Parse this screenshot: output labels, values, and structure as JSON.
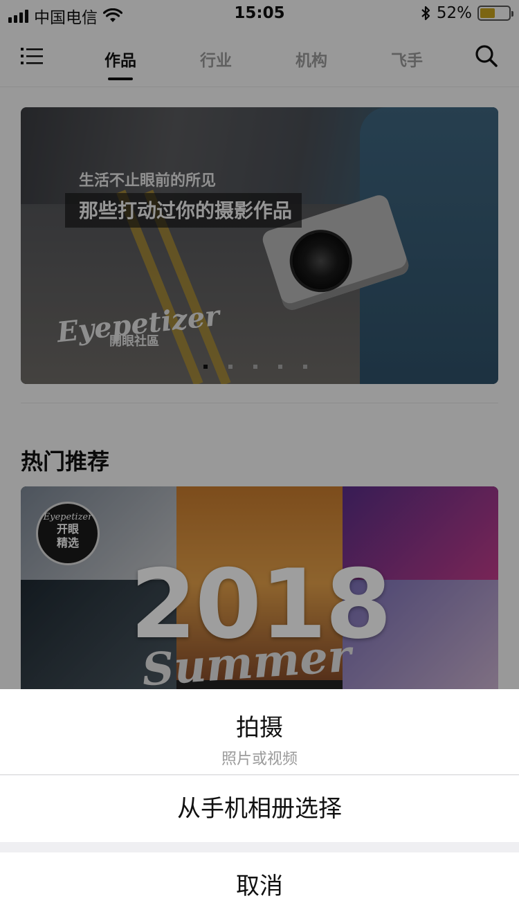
{
  "status_bar": {
    "carrier": "中国电信",
    "time": "15:05",
    "battery_text": "52%",
    "battery_level": 0.52
  },
  "nav": {
    "tabs": [
      {
        "label": "作品",
        "active": true
      },
      {
        "label": "行业",
        "active": false
      },
      {
        "label": "机构",
        "active": false
      },
      {
        "label": "飞手",
        "active": false
      }
    ],
    "icons": [
      "menu-icon",
      "search-icon"
    ]
  },
  "banner": {
    "line1": "生活不止眼前的所见",
    "line2": "那些打动过你的摄影作品",
    "logo": "Eyepetizer",
    "logo_sub": "開眼社區",
    "dot_count": 5,
    "active_dot": 0
  },
  "section": {
    "title": "热门推荐"
  },
  "hot_card": {
    "badge_brand": "Eyepetizer",
    "badge_line1": "开眼",
    "badge_line2": "精选",
    "year": "2018",
    "season": "Summer"
  },
  "action_sheet": {
    "shoot_label": "拍摄",
    "shoot_sub": "照片或视频",
    "album_label": "从手机相册选择",
    "cancel_label": "取消"
  },
  "colors": {
    "accent_battery": "#c9a41e",
    "overlay": "rgba(0,0,0,0.38)",
    "text_primary": "#111111",
    "text_secondary": "#9a9a9a"
  }
}
